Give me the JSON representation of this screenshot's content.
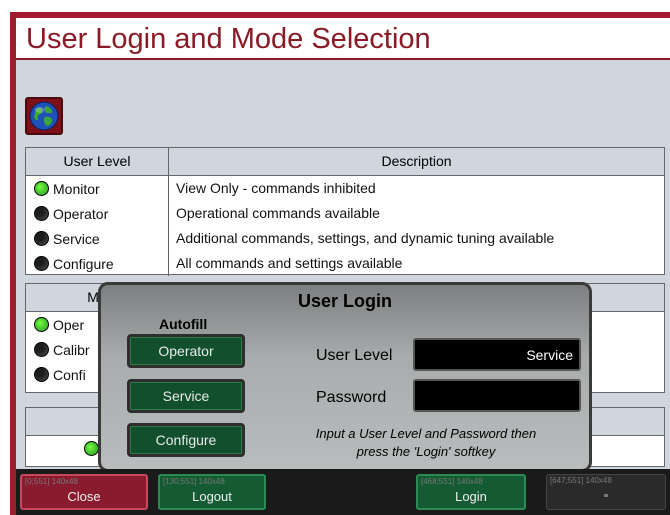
{
  "page_title": "User Login and Mode Selection",
  "user_table": {
    "col_level": "User Level",
    "col_description": "Description",
    "rows": [
      {
        "level": "Monitor",
        "description": "View Only - commands inhibited",
        "active": true
      },
      {
        "level": "Operator",
        "description": "Operational commands available",
        "active": false
      },
      {
        "level": "Service",
        "description": "Additional commands, settings, and dynamic tuning available",
        "active": false
      },
      {
        "level": "Configure",
        "description": "All commands and settings available",
        "active": false
      }
    ]
  },
  "mode_table": {
    "col_mode": "Mo",
    "rows": [
      {
        "label": "Oper",
        "active": true
      },
      {
        "label": "Calibr",
        "active": false
      },
      {
        "label": "Confi",
        "active": false
      }
    ]
  },
  "dialog": {
    "title": "User Login",
    "autofill_label": "Autofill",
    "autofill_buttons": [
      "Operator",
      "Service",
      "Configure"
    ],
    "user_level_label": "User Level",
    "user_level_value": "Service",
    "password_label": "Password",
    "password_value": "",
    "hint_line1": "Input a User Level and Password then",
    "hint_line2": "press the 'Login' softkey"
  },
  "softkeys": {
    "close": {
      "label": "Close",
      "dims": "[0;551] 140x48"
    },
    "logout": {
      "label": "Logout",
      "dims": "[130;551] 140x48"
    },
    "login": {
      "label": "Login",
      "dims": "[468;551] 140x48"
    },
    "empty": {
      "label": "",
      "dims": "[647;551] 140x48"
    }
  }
}
